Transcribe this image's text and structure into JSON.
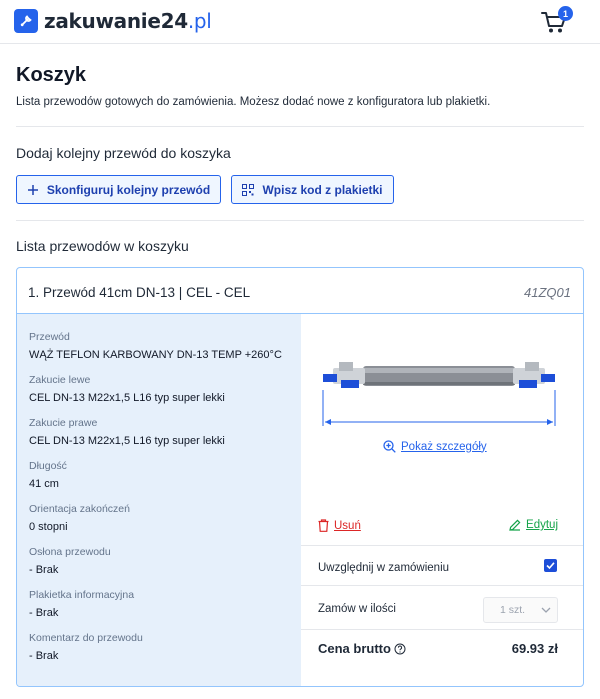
{
  "header": {
    "logo_text": "zakuwanie24",
    "logo_tld": ".pl",
    "cart_count": "1"
  },
  "page": {
    "title": "Koszyk",
    "subtitle": "Lista przewodów gotowych do zamówienia. Możesz dodać nowe z konfiguratora lub plakietki."
  },
  "add_section": {
    "title": "Dodaj kolejny przewód do koszyka",
    "configure_label": "Skonfiguruj kolejny przewód",
    "code_label": "Wpisz kod z plakietki"
  },
  "list_section": {
    "title": "Lista przewodów w koszyku"
  },
  "item": {
    "title": "1. Przewód 41cm DN-13 | CEL - CEL",
    "code": "41ZQ01",
    "specs": [
      {
        "label": "Przewód",
        "value": "WĄŻ TEFLON KARBOWANY DN-13 TEMP +260°C"
      },
      {
        "label": "Zakucie lewe",
        "value": "CEL DN-13 M22x1,5 L16 typ super lekki"
      },
      {
        "label": "Zakucie prawe",
        "value": "CEL DN-13 M22x1,5 L16 typ super lekki"
      },
      {
        "label": "Długość",
        "value": "41 cm"
      },
      {
        "label": "Orientacja zakończeń",
        "value": "0 stopni"
      },
      {
        "label": "Osłona przewodu",
        "value": "- Brak"
      },
      {
        "label": "Plakietka informacyjna",
        "value": "- Brak"
      },
      {
        "label": "Komentarz do przewodu",
        "value": "- Brak"
      }
    ],
    "details_label": "Pokaż szczegóły",
    "remove_label": "Usuń",
    "edit_label": "Edytuj",
    "include_label": "Uwzględnij w zamówieniu",
    "include_checked": true,
    "quantity_label": "Zamów w ilości",
    "quantity_value": "1 szt.",
    "price_label": "Cena brutto",
    "price_value": "69.93 zł"
  },
  "colors": {
    "accent": "#2563eb",
    "specs_bg": "#e6f0fb",
    "remove": "#dc2626",
    "edit": "#16a34a"
  }
}
